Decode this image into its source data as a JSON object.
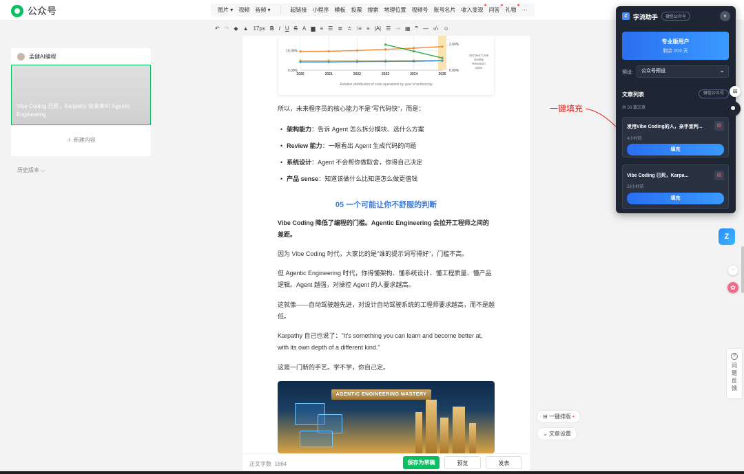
{
  "header": {
    "brand": "公众号",
    "menu": [
      {
        "label": "图片",
        "caret": true,
        "dot": false
      },
      {
        "label": "视频",
        "caret": false,
        "dot": false
      },
      {
        "label": "音频",
        "caret": true,
        "dot": false
      }
    ],
    "menu2": [
      {
        "label": "超链接",
        "dot": false
      },
      {
        "label": "小程序",
        "dot": false
      },
      {
        "label": "模板",
        "dot": false
      },
      {
        "label": "投票",
        "dot": false
      },
      {
        "label": "搜索",
        "dot": false
      },
      {
        "label": "地理位置",
        "dot": false
      },
      {
        "label": "视频号",
        "dot": false
      },
      {
        "label": "账号名片",
        "dot": false
      },
      {
        "label": "收入变现",
        "dot": true
      },
      {
        "label": "问答",
        "dot": true
      },
      {
        "label": "礼物",
        "dot": true
      },
      {
        "label": "···",
        "dot": false
      }
    ]
  },
  "toolbar": {
    "undo": "↶",
    "redo": "↷",
    "format_painter": "◆",
    "clear": "▲",
    "font_size": "17px",
    "bold": "B",
    "italic": "I",
    "underline": "U",
    "strike": "S",
    "font_color": "A",
    "bg_color": "▆",
    "align1": "≡",
    "align2": "☰",
    "align3": "≣",
    "align4": "≐",
    "list1": "⁝≡",
    "list2": "≡",
    "spacing": "|A|",
    "list3": "☰",
    "indent": "⇥",
    "table": "▦",
    "quote": "❞",
    "divider": "—",
    "code": "‹/›",
    "emoji": "☺"
  },
  "left": {
    "account_name": "孟健AI编程",
    "article_title": "Vibe Coding 已死，Karpathy 说未来叫 Agentic Engineering",
    "new_content": "新建内容",
    "history": "历史版本"
  },
  "article": {
    "chart_caption": "Relative distribution of code operations by year of authorship",
    "chart_note": [
      "GitClear Code",
      "Quality",
      "Research",
      "2025"
    ],
    "p1": "所以，未来程序员的核心能力不是\"写代码快\"，而是：",
    "bullets": [
      {
        "strong": "架构能力",
        "text": "：告诉 Agent 怎么拆分模块、选什么方案"
      },
      {
        "strong": "Review 能力",
        "text": "：一眼看出 Agent 生成代码的问题"
      },
      {
        "strong": "系统设计",
        "text": "：Agent 不会帮你做取舍，你得自己决定"
      },
      {
        "strong": "产品 sense",
        "text": "：知道该做什么比知道怎么做更值钱"
      }
    ],
    "section_title": "05 一个可能让你不舒服的判断",
    "p2": "Vibe Coding 降低了编程的门槛。Agentic Engineering 会拉开工程师之间的差距。",
    "p3": "因为 Vibe Coding 时代，大家比的是\"谁的提示词写得好\"，门槛不高。",
    "p4": "但 Agentic Engineering 时代，你得懂架构、懂系统设计、懂工程质量、懂产品逻辑。Agent 越强，对操控 Agent 的人要求越高。",
    "p5": "这就像——自动驾驶越先进，对设计自动驾驶系统的工程师要求越高，而不是越低。",
    "p6": "Karpathy 自己也说了：\"It's something you can learn and become better at, with its own depth of a different kind.\"",
    "p7": "这是一门新的手艺。学不学，你自己定。",
    "banner_title": "AGENTIC ENGINEERING MASTERY"
  },
  "chart_data": {
    "type": "line",
    "x": [
      "2020",
      "2021",
      "2022",
      "2023",
      "2024",
      "2025"
    ],
    "series": [
      {
        "values": [
          9.5,
          9.6,
          10.0,
          10.6,
          11.2,
          12.0
        ],
        "color": "#f08a3a"
      },
      {
        "values": [
          null,
          null,
          null,
          13.0,
          9.6,
          6.2
        ],
        "color": "#3aaa4a"
      },
      {
        "values": [
          5.0,
          5.0,
          5.0,
          5.0,
          5.0,
          5.0
        ],
        "color": "#e8c23a"
      },
      {
        "values": [
          4.2,
          4.2,
          4.3,
          4.4,
          4.5,
          4.8
        ],
        "color": "#3a8fd8"
      }
    ],
    "y_ticks_left": [
      "10.00%",
      "0.00%"
    ],
    "y_ticks_right": [
      "2.00%",
      "0.00%"
    ],
    "grid": true
  },
  "bottom": {
    "wordcount_label": "正文字数",
    "wordcount_value": "1864",
    "save": "保存为草稿",
    "preview": "预览",
    "publish": "发表"
  },
  "side_pills": {
    "auto_layout": "一键排版",
    "article_settings": "文章设置"
  },
  "annotation": "一键填充",
  "assistant": {
    "title": "字流助手",
    "tag": "微信公众号",
    "close": "×",
    "pro_title": "专业版用户",
    "pro_remaining": "剩余 203 天",
    "preset_label": "预设:",
    "preset_value": "公众号预设",
    "list_title": "文章列表",
    "list_tag": "微信公众号",
    "list_count": "共 56 篇文章",
    "cards": [
      {
        "title": "发用Vibe Coding的人，亲手宣判...",
        "time": "4小时前",
        "fill": "填充"
      },
      {
        "title": "Vibe Coding 已死，Karpa...",
        "time": "23小时前",
        "fill": "填充"
      }
    ]
  },
  "right_edge": {
    "zz_logo": "Z",
    "feedback": "问题反馈",
    "feedback_icon": "?"
  },
  "colors": {
    "brand_green": "#07c160",
    "accent_blue": "#3b7bd8",
    "assistant_bg": "#1f2633",
    "annotation_red": "#e02020"
  }
}
